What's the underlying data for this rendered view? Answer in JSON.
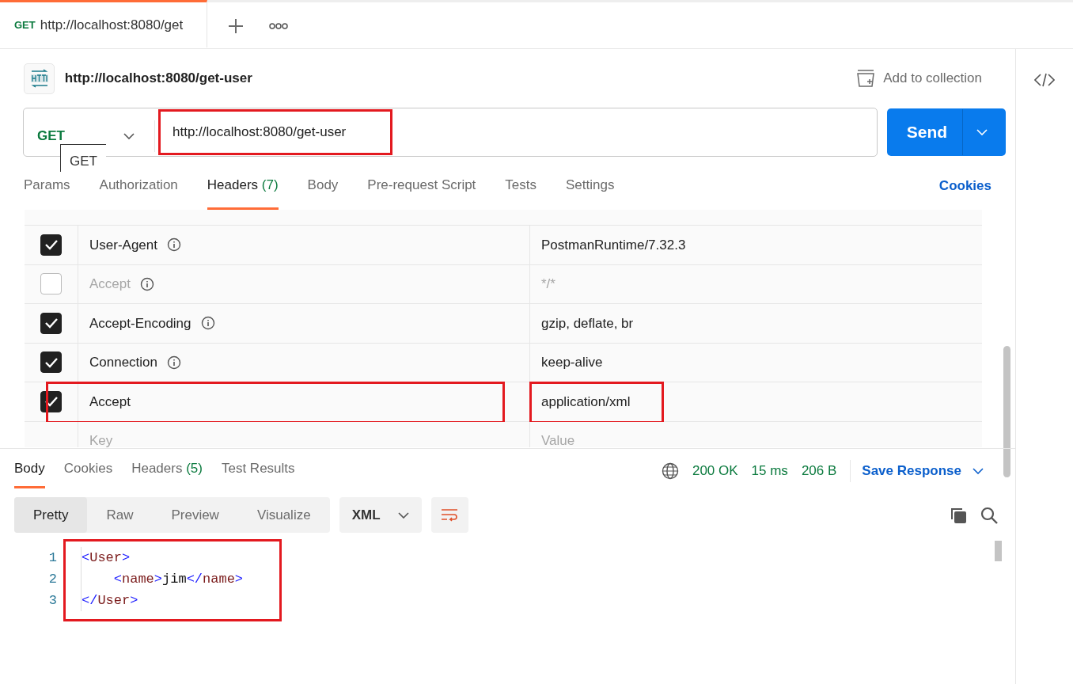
{
  "tab": {
    "method": "GET",
    "title": "http://localhost:8080/get",
    "selected": true
  },
  "request": {
    "title": "http://localhost:8080/get-user",
    "add_to_collection": "Add to collection",
    "method": "GET",
    "url": "http://localhost:8080/get-user",
    "url_highlighted": true,
    "send": "Send",
    "tooltip": "GET"
  },
  "request_tabs": [
    {
      "label": "Params",
      "selected": false
    },
    {
      "label": "Authorization",
      "selected": false
    },
    {
      "label": "Headers",
      "count": "(7)",
      "selected": true
    },
    {
      "label": "Body",
      "selected": false
    },
    {
      "label": "Pre-request Script",
      "selected": false
    },
    {
      "label": "Tests",
      "selected": false
    },
    {
      "label": "Settings",
      "selected": false
    }
  ],
  "cookies_link": "Cookies",
  "headers": [
    {
      "key": "User-Agent",
      "value": "PostmanRuntime/7.32.3",
      "checked": true,
      "info": true,
      "highlighted": false
    },
    {
      "key": "Accept",
      "value": "*/*",
      "checked": false,
      "info": true,
      "highlighted": false
    },
    {
      "key": "Accept-Encoding",
      "value": "gzip, deflate, br",
      "checked": true,
      "info": true,
      "highlighted": false
    },
    {
      "key": "Connection",
      "value": "keep-alive",
      "checked": true,
      "info": true,
      "highlighted": false
    },
    {
      "key": "Accept",
      "value": "application/xml",
      "checked": true,
      "info": false,
      "highlighted": true
    }
  ],
  "new_row": {
    "key_placeholder": "Key",
    "value_placeholder": "Value"
  },
  "response": {
    "tabs": [
      {
        "label": "Body",
        "selected": true
      },
      {
        "label": "Cookies",
        "selected": false
      },
      {
        "label": "Headers",
        "count": "(5)",
        "selected": false
      },
      {
        "label": "Test Results",
        "selected": false
      }
    ],
    "status": "200 OK",
    "time": "15 ms",
    "size": "206 B",
    "save": "Save Response",
    "view_modes": [
      {
        "label": "Pretty",
        "selected": true
      },
      {
        "label": "Raw",
        "selected": false
      },
      {
        "label": "Preview",
        "selected": false
      },
      {
        "label": "Visualize",
        "selected": false
      }
    ],
    "format": "XML",
    "code_highlighted": true,
    "code_lines": [
      {
        "number": "1",
        "tokens": [
          {
            "kind": "punct",
            "text": "<"
          },
          {
            "kind": "tag",
            "text": "User"
          },
          {
            "kind": "punct",
            "text": ">"
          }
        ]
      },
      {
        "number": "2",
        "tokens": [
          {
            "kind": "punct",
            "text": "    <"
          },
          {
            "kind": "tag",
            "text": "name"
          },
          {
            "kind": "punct",
            "text": ">"
          },
          {
            "kind": "text",
            "text": "jim"
          },
          {
            "kind": "punct",
            "text": "</"
          },
          {
            "kind": "tag",
            "text": "name"
          },
          {
            "kind": "punct",
            "text": ">"
          }
        ]
      },
      {
        "number": "3",
        "tokens": [
          {
            "kind": "punct",
            "text": "</"
          },
          {
            "kind": "tag",
            "text": "User"
          },
          {
            "kind": "punct",
            "text": ">"
          }
        ]
      }
    ]
  }
}
